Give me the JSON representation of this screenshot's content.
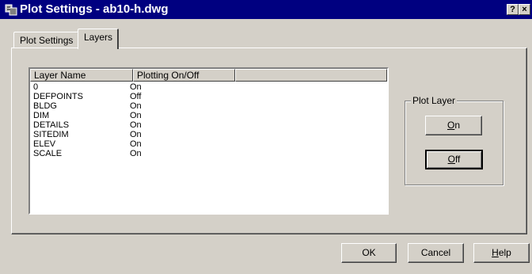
{
  "window": {
    "title": "Plot Settings - ab10-h.dwg",
    "help_glyph": "?",
    "close_glyph": "×"
  },
  "tabs": [
    {
      "label": "Plot Settings"
    },
    {
      "label": "Layers"
    }
  ],
  "list": {
    "headers": [
      "Layer Name",
      "Plotting On/Off",
      ""
    ],
    "rows": [
      {
        "name": "0",
        "plotting": "On"
      },
      {
        "name": "DEFPOINTS",
        "plotting": "Off"
      },
      {
        "name": "BLDG",
        "plotting": "On"
      },
      {
        "name": "DIM",
        "plotting": "On"
      },
      {
        "name": "DETAILS",
        "plotting": "On"
      },
      {
        "name": "SITEDIM",
        "plotting": "On"
      },
      {
        "name": "ELEV",
        "plotting": "On"
      },
      {
        "name": "SCALE",
        "plotting": "On"
      }
    ]
  },
  "plot_layer": {
    "label": "Plot Layer",
    "on": {
      "mn": "O",
      "rest": "n"
    },
    "off": {
      "mn": "O",
      "rest": "ff"
    }
  },
  "footer": {
    "ok": "OK",
    "cancel": "Cancel",
    "help": {
      "mn": "H",
      "rest": "elp"
    }
  }
}
